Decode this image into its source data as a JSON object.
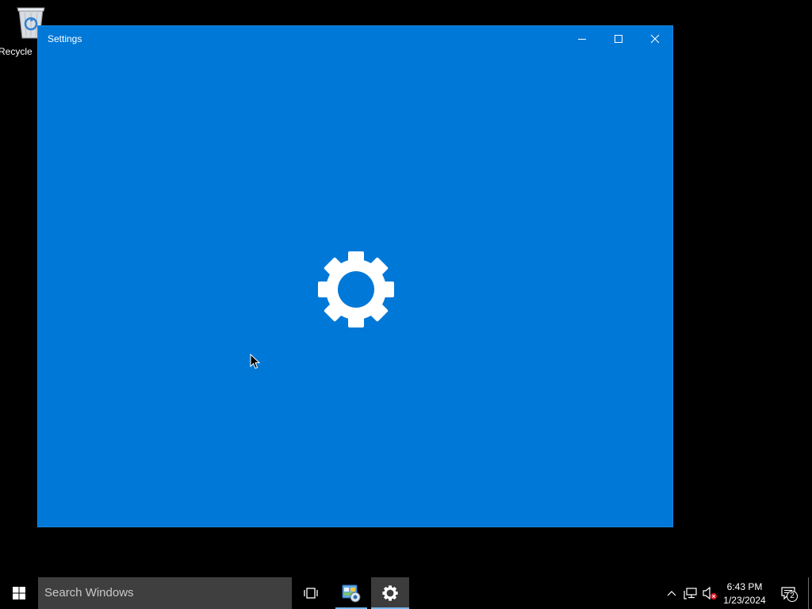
{
  "desktop": {
    "icons": [
      {
        "label": "Recycle",
        "icon": "recycle-bin-icon"
      }
    ]
  },
  "window": {
    "title": "Settings",
    "controls": [
      "minimize-icon",
      "maximize-icon",
      "close-icon"
    ],
    "splash_icon": "gear-icon",
    "background_color": "#0078d7"
  },
  "taskbar": {
    "start_icon": "windows-logo-icon",
    "search_placeholder": "Search Windows",
    "buttons": [
      {
        "name": "task-view",
        "icon": "task-view-icon",
        "active": false
      },
      {
        "name": "control-panel",
        "icon": "control-panel-icon",
        "active": false,
        "running": true
      },
      {
        "name": "settings",
        "icon": "gear-icon",
        "active": true,
        "running": true
      }
    ],
    "tray_icons": [
      "chevron-up-icon",
      "network-icon",
      "volume-muted-icon"
    ],
    "clock": {
      "time": "6:43 PM",
      "date": "1/23/2024"
    },
    "notifications": {
      "icon": "action-center-icon",
      "count": "2"
    },
    "accent_color": "#76b9ed"
  }
}
